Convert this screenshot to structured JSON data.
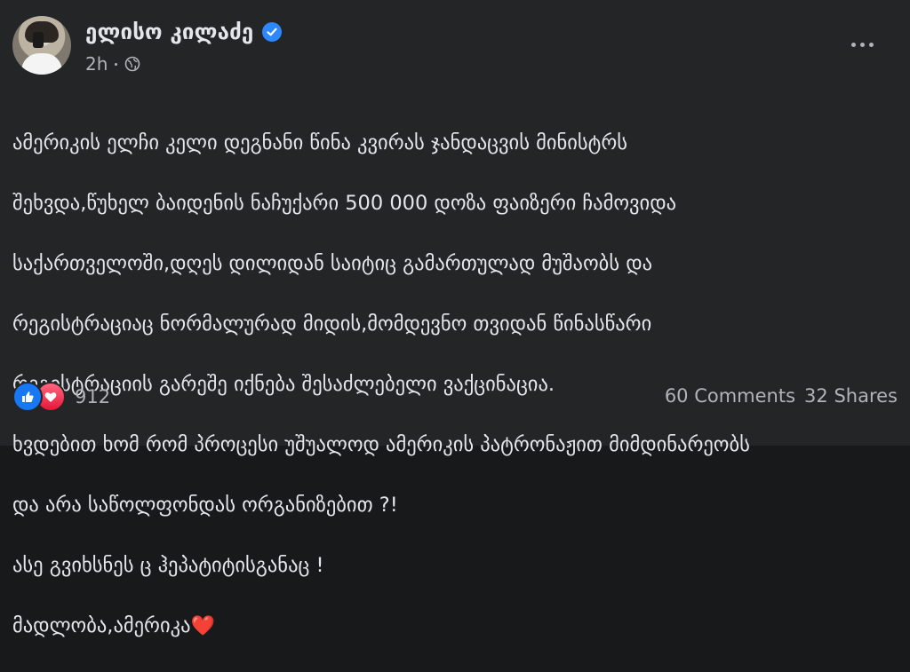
{
  "post": {
    "author": "ელისო კილაძე",
    "time": "2h",
    "lines": [
      "ამერიკის ელჩი კელი  დეგნანი წინა კვირას ჯანდაცვის მინისტრს",
      "შეხვდა,წუხელ ბაიდენის  ნაჩუქარი 500 000 დოზა ფაიზერი ჩამოვიდა",
      "საქართველოში,დღეს დილიდან საიტიც გამართულად მუშაობს და",
      "რეგისტრაციაც ნორმალურად მიდის,მომდევნო თვიდან წინასწარი",
      "რეგისტრაციის გარეშე იქნება შესაძლებელი ვაქცინაცია.",
      "ხვდებით ხომ რომ პროცესი უშუალოდ ამერიკის პატრონაჟით მიმდინარეობს",
      "და არა საწოლფონდას ორგანიზებით ?!",
      "ასე გვიხსნეს ც ჰეპატიტისგანაც !",
      "მადლობა,ამერიკა"
    ],
    "last_line_emoji": "❤️",
    "reaction_count": "912",
    "comments": "60 Comments",
    "shares": "32 Shares"
  },
  "icons": {
    "verified": "verified-badge-icon",
    "audience": "globe-icon",
    "more": "more-options-icon",
    "like": "like-reaction-icon",
    "love": "love-reaction-icon"
  },
  "colors": {
    "background": "#242526",
    "text": "#e4e6eb",
    "secondary": "#b0b3b8",
    "verified": "#2d88ff",
    "like": "#1877f2",
    "love": "#e61739"
  }
}
